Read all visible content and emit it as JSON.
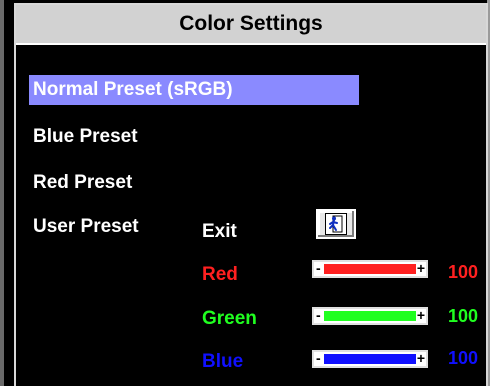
{
  "title": "Color Settings",
  "presets": [
    {
      "label": "Normal Preset (sRGB)",
      "selected": true
    },
    {
      "label": "Blue Preset",
      "selected": false
    },
    {
      "label": "Red Preset",
      "selected": false
    },
    {
      "label": "User Preset",
      "selected": false
    }
  ],
  "user_preset": {
    "exit_label": "Exit",
    "exit_icon": "running-man-exit-icon",
    "channels": [
      {
        "label": "Red",
        "value": "100",
        "level": 1.0,
        "color": "#ff2020"
      },
      {
        "label": "Green",
        "value": "100",
        "level": 1.0,
        "color": "#20ff20"
      },
      {
        "label": "Blue",
        "value": "100",
        "level": 1.0,
        "color": "#1010ff"
      }
    ]
  },
  "colors": {
    "highlight": "#8a8aff",
    "title_bar": "#d2d2d2",
    "background": "#000000"
  }
}
